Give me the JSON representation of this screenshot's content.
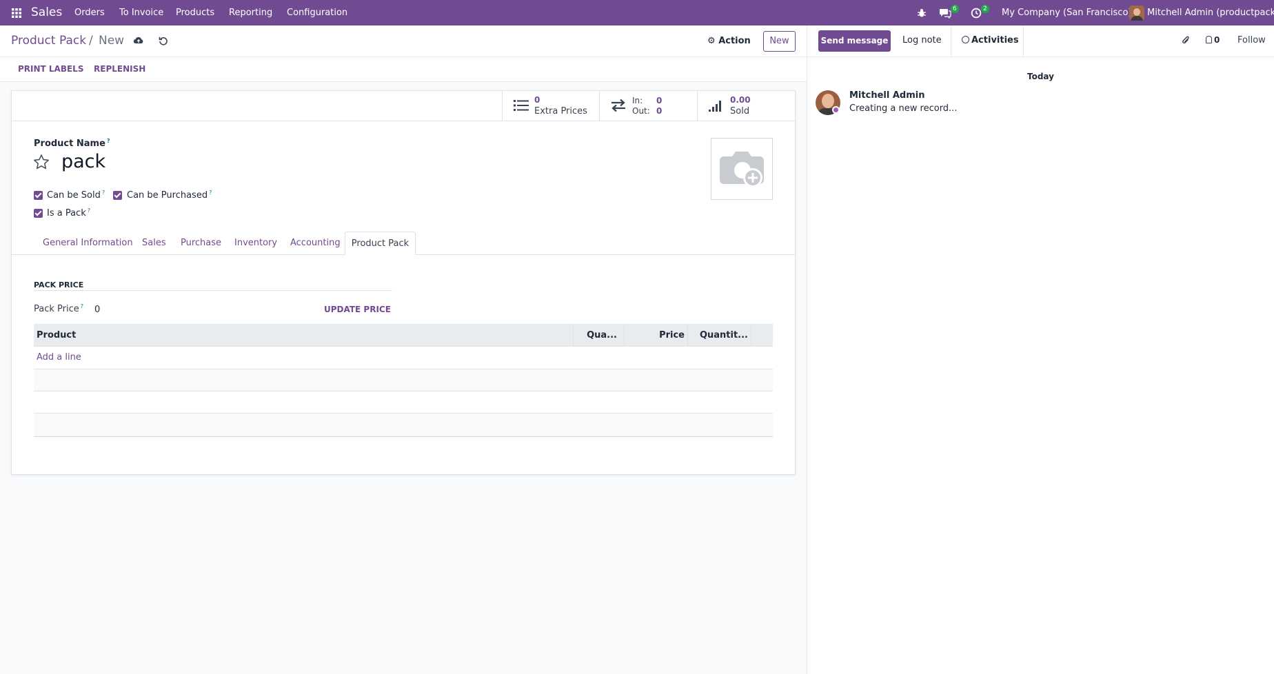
{
  "navbar": {
    "app_name": "Sales",
    "menu": [
      "Orders",
      "To Invoice",
      "Products",
      "Reporting",
      "Configuration"
    ],
    "messages_count": "6",
    "activities_count": "2",
    "company": "My Company (San Francisco)",
    "user": "Mitchell Admin (productpack)"
  },
  "control": {
    "breadcrumb_parent": "Product Pack",
    "breadcrumb_sep": "/",
    "breadcrumb_current": "New",
    "action_label": "Action",
    "new_label": "New"
  },
  "buttons": {
    "print_labels": "PRINT LABELS",
    "replenish": "REPLENISH"
  },
  "stats": {
    "extra_prices_value": "0",
    "extra_prices_label": "Extra Prices",
    "in_label": "In:",
    "in_value": "0",
    "out_label": "Out:",
    "out_value": "0",
    "sold_value": "0.00",
    "sold_label": "Sold"
  },
  "form": {
    "product_name_label": "Product Name",
    "tooltip_mark": "?",
    "product_name_value": "pack",
    "can_be_sold": "Can be Sold",
    "can_be_purchased": "Can be Purchased",
    "is_a_pack": "Is a Pack"
  },
  "tabs": [
    "General Information",
    "Sales",
    "Purchase",
    "Inventory",
    "Accounting",
    "Product Pack"
  ],
  "pack": {
    "section_title": "PACK PRICE",
    "pack_price_label": "Pack Price",
    "pack_price_value": "0",
    "update_price": "UPDATE PRICE",
    "columns": [
      "Product",
      "Qua...",
      "Price",
      "Quantit..."
    ],
    "add_line": "Add a line"
  },
  "chatter": {
    "send_message": "Send message",
    "log_note": "Log note",
    "activities": "Activities",
    "followers_count": "0",
    "follow": "Follow",
    "date_separator": "Today",
    "author": "Mitchell Admin",
    "message": "Creating a new record..."
  },
  "colors": {
    "brand": "#714b92",
    "badge": "#1fa94c",
    "tooltip": "#017e84"
  }
}
